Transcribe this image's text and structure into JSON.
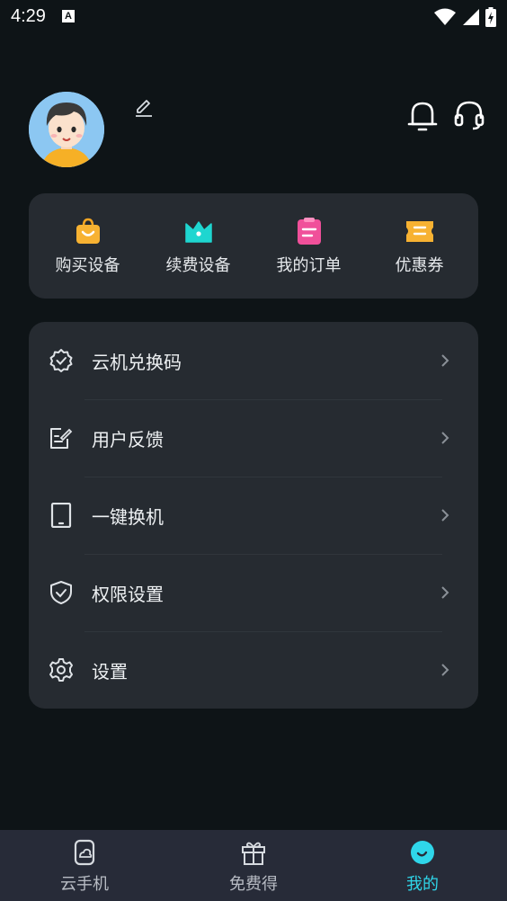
{
  "status_bar": {
    "time": "4:29",
    "notification_glyph": "A"
  },
  "profile": {
    "avatar": "avatar-illustration"
  },
  "quick_actions": [
    {
      "label": "购买设备",
      "icon": "shopping-bag-icon",
      "color": "#f5a623"
    },
    {
      "label": "续费设备",
      "icon": "crown-icon",
      "color": "#1ed6d0"
    },
    {
      "label": "我的订单",
      "icon": "clipboard-icon",
      "color": "#f0509a"
    },
    {
      "label": "优惠券",
      "icon": "coupon-icon",
      "color": "#f5a623"
    }
  ],
  "menu": [
    {
      "label": "云机兑换码",
      "icon": "badge-check-icon"
    },
    {
      "label": "用户反馈",
      "icon": "feedback-icon"
    },
    {
      "label": "一键换机",
      "icon": "tablet-icon"
    },
    {
      "label": "权限设置",
      "icon": "shield-check-icon"
    },
    {
      "label": "设置",
      "icon": "gear-icon"
    }
  ],
  "bottom_nav": [
    {
      "label": "云手机",
      "icon": "cloud-phone-icon",
      "active": false
    },
    {
      "label": "免费得",
      "icon": "gift-icon",
      "active": false
    },
    {
      "label": "我的",
      "icon": "mine-icon",
      "active": true
    }
  ],
  "colors": {
    "background": "#0e1417",
    "card": "#262b31",
    "accent": "#2fd6ea",
    "nav_bg": "#272b38"
  }
}
